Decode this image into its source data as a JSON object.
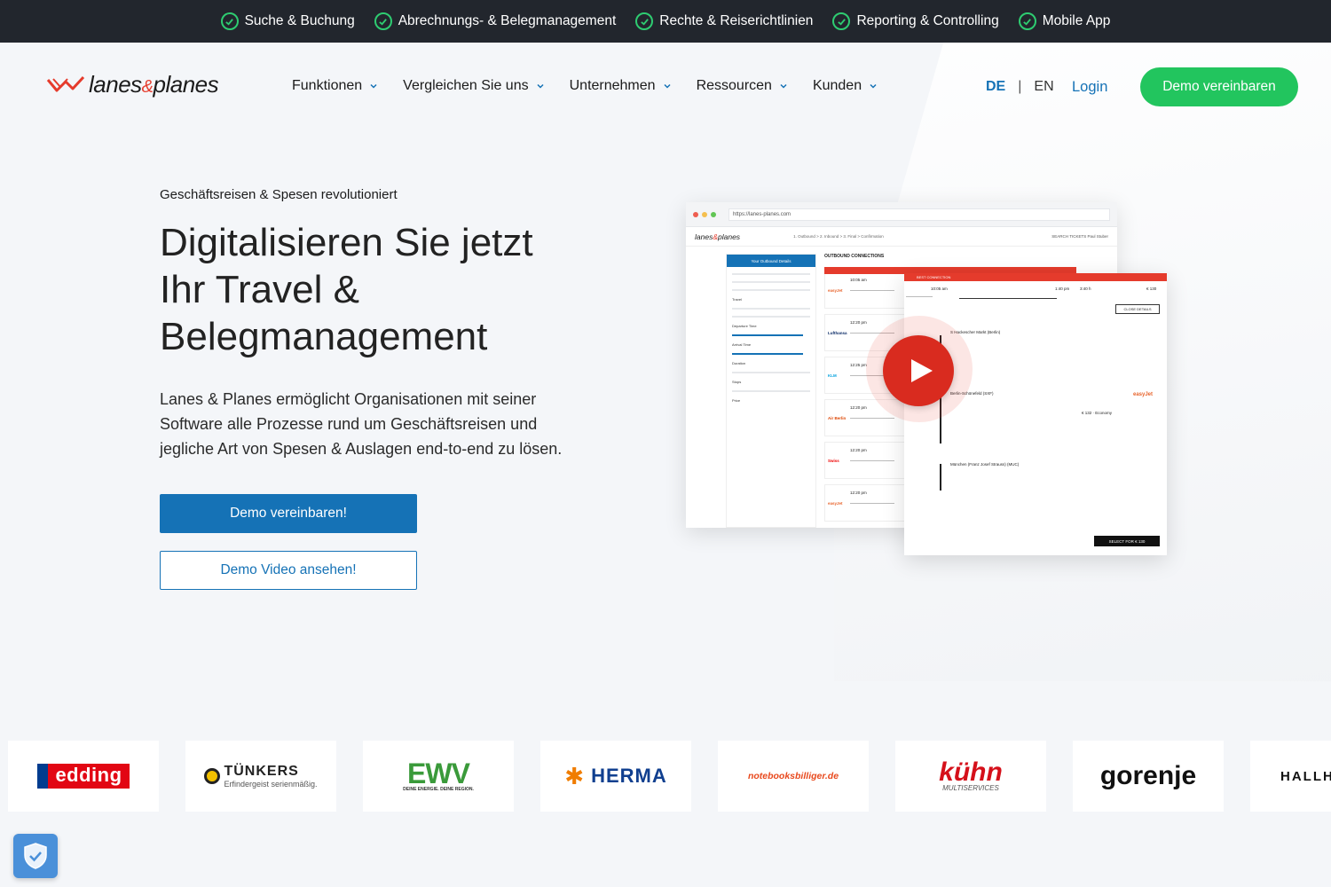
{
  "topbar": {
    "features": [
      "Suche & Buchung",
      "Abrechnungs- & Belegmanagement",
      "Rechte & Reiserichtlinien",
      "Reporting & Controlling",
      "Mobile App"
    ]
  },
  "nav": {
    "logo_text_1": "lanes",
    "logo_amp": "&",
    "logo_text_2": "planes",
    "menu": [
      "Funktionen",
      "Vergleichen Sie uns",
      "Unternehmen",
      "Ressourcen",
      "Kunden"
    ],
    "lang_de": "DE",
    "lang_sep": "|",
    "lang_en": "EN",
    "login": "Login",
    "demo_button": "Demo vereinbaren"
  },
  "hero": {
    "eyebrow": "Geschäftsreisen & Spesen revolutioniert",
    "headline_lines": [
      "Digitalisieren Sie jetzt",
      "Ihr Travel &",
      "Belegmanagement"
    ],
    "lead": "Lanes & Planes ermöglicht Organisationen mit seiner Software alle Prozesse rund um Geschäftsreisen und jegliche Art von Spesen & Auslagen end-to-end zu lösen.",
    "primary_button": "Demo vereinbaren!",
    "secondary_button": "Demo Video ansehen!"
  },
  "mockup": {
    "url": "https://lanes-planes.com",
    "app_logo_1": "lanes",
    "app_logo_amp": "&",
    "app_logo_2": "planes",
    "steps": "1. Outbound   >   2. Inbound   >   3. Final   >   Confirmation",
    "header_right": "SEARCH   TICKETS   Paul Stuber",
    "filter_title": "Your Outbound Details",
    "filter_labels": [
      "Travel",
      "Departure Time",
      "Arrival Time",
      "Duration",
      "Stops",
      "Price"
    ],
    "results_title": "OUTBOUND CONNECTIONS",
    "best_label": "BEST CONNECTION",
    "result_cards": [
      {
        "airline": "easyJet",
        "time": "10:05 am"
      },
      {
        "airline": "Lufthansa",
        "time": "12:20 pm"
      },
      {
        "airline": "KLM",
        "time": "12:25 pm"
      },
      {
        "airline": "Air Berlin",
        "time": "12:20 pm"
      },
      {
        "airline": "Swiss",
        "time": "12:20 pm"
      },
      {
        "airline": "easyJet",
        "time": "12:20 pm"
      }
    ],
    "detail": {
      "best_label": "BEST CONNECTION",
      "time_start": "10:05 am",
      "time_end": "1:40 pm",
      "duration": "3:40 h",
      "price": "€ 130",
      "close_label": "CLOSE DETAILS",
      "stop_1": "S Hackescher Markt (Berlin)",
      "stop_2": "Berlin-Schönefeld (SXF)",
      "stop_3": "München (Franz Josef Strauss) (MUC)",
      "class_label": "€ 132 · Economy",
      "airline": "easyJet",
      "select_label": "SELECT FOR € 130"
    }
  },
  "clients": [
    "edding",
    "TÜNKERS",
    "EWV",
    "HERMA",
    "notebooksbilliger.de",
    "kühn",
    "gorenje",
    "HALLH"
  ],
  "client_sub": {
    "tunkers": "Erfindergeist serienmäßig.",
    "ewv": "DEINE ENERGIE. DEINE REGION.",
    "kuhn": "MULTISERVICES"
  },
  "colors": {
    "brand_blue": "#1572b6",
    "brand_green": "#22c55e",
    "brand_red": "#e53b2c",
    "topbar_bg": "#22262d"
  },
  "icons": [
    "check-circle-icon",
    "chevron-down-icon",
    "play-icon",
    "shield-check-icon"
  ]
}
